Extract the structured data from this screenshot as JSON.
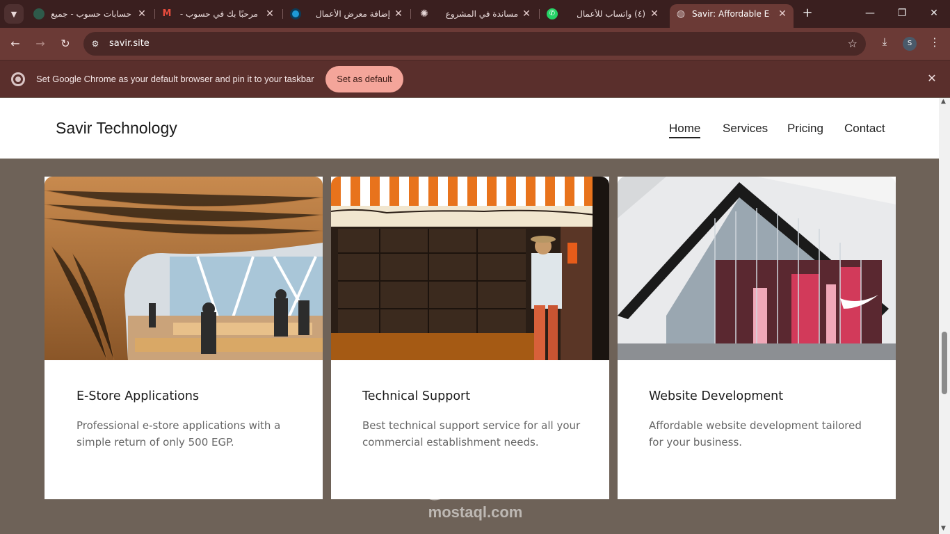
{
  "browser": {
    "tabs": [
      {
        "title": "حسابات حسوب - جميع",
        "icon": "generic-dot-icon"
      },
      {
        "title": "مرحبًا بك في حسوب -",
        "icon": "gmail-icon"
      },
      {
        "title": "إضافة معرض الأعمال",
        "icon": "circle-blue-icon"
      },
      {
        "title": "مساندة في المشروع",
        "icon": "openai-icon"
      },
      {
        "title": "(٤) واتساب للأعمال",
        "icon": "whatsapp-icon"
      },
      {
        "title": "Savir: Affordable E-St",
        "icon": "globe-icon",
        "active": true
      }
    ],
    "url": "savir.site",
    "profile_initial": "S"
  },
  "infobar": {
    "message": "Set Google Chrome as your default browser and pin it to your taskbar",
    "button_label": "Set as default"
  },
  "site": {
    "brand": "Savir Technology",
    "nav": [
      {
        "label": "Home",
        "active": true
      },
      {
        "label": "Services"
      },
      {
        "label": "Pricing"
      },
      {
        "label": "Contact"
      }
    ],
    "cards": [
      {
        "title": "E-Store Applications",
        "text": "Professional e-store applications with a simple return of only 500 EGP.",
        "image": "store-interior-photo"
      },
      {
        "title": "Technical Support",
        "text": "Best technical support service for all your commercial establishment needs.",
        "image": "coffee-store-photo"
      },
      {
        "title": "Website Development",
        "text": "Affordable website development tailored for your business.",
        "image": "retail-storefront-photo"
      }
    ]
  },
  "watermark": {
    "arabic": "مستقل",
    "latin": "mostaql.com"
  }
}
